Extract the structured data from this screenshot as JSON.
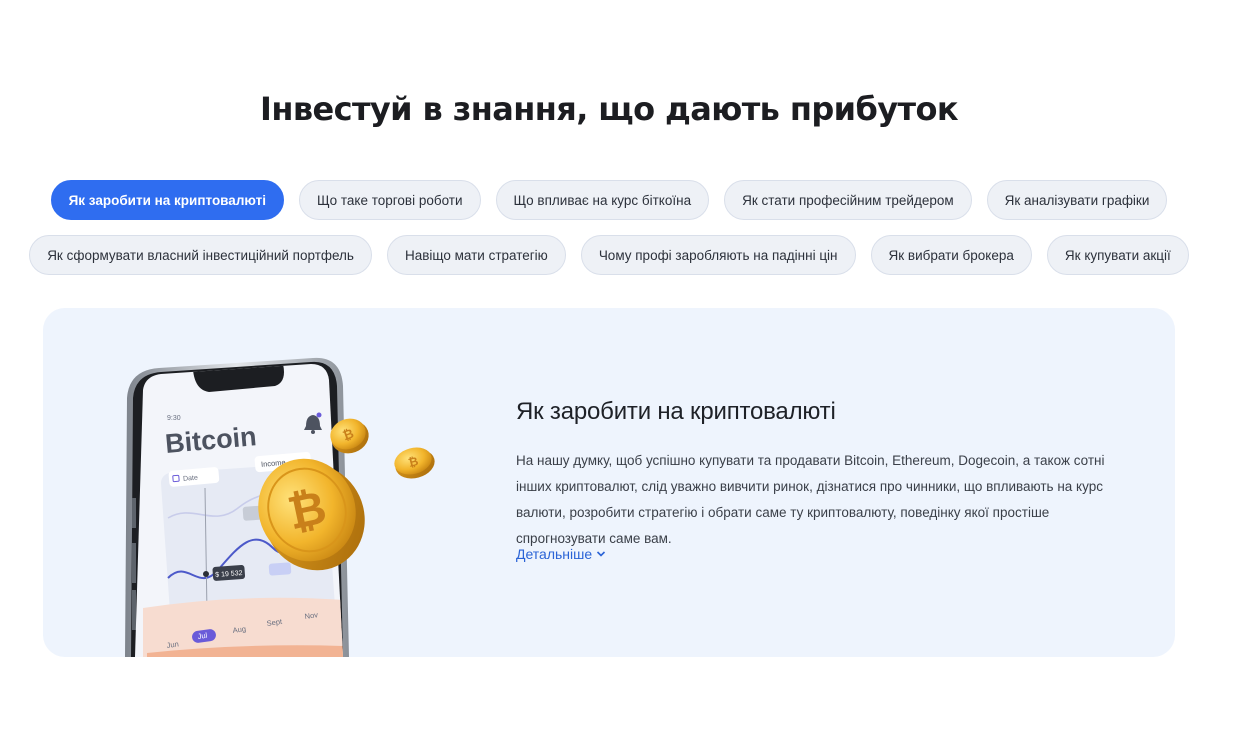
{
  "heading": "Інвестуй в знання, що дають прибуток",
  "topics_row1": [
    {
      "label": "Як заробити на криптовалюті",
      "active": true
    },
    {
      "label": "Що таке торгові роботи"
    },
    {
      "label": "Що впливає на курс біткоїна"
    },
    {
      "label": "Як стати професійним трейдером"
    },
    {
      "label": "Як аналізувати графіки"
    }
  ],
  "topics_row2": [
    {
      "label": "Як сформувати власний інвестиційний портфель"
    },
    {
      "label": "Навіщо мати стратегію"
    },
    {
      "label": "Чому профі заробляють на падінні цін"
    },
    {
      "label": "Як вибрати брокера"
    },
    {
      "label": "Як купувати акції"
    }
  ],
  "card": {
    "title": "Як заробити на криптовалюті",
    "text": "На нашу думку, щоб успішно купувати та продавати Bitcoin, Ethereum, Dogecoin, а також сотні інших криптовалют, слід уважно вивчити ринок, дізнатися про чинники, що впливають на курс валюти, розробити стратегію і обрати саме ту криптовалюту, поведінку якої простіше спрогнозувати саме вам.",
    "more_label": "Детальніше"
  },
  "phone": {
    "time": "9:30",
    "app_title": "Bitcoin",
    "date_label": "Date",
    "income_label": "Income",
    "price_tag": "$ 19 532",
    "months": [
      "Jun",
      "Jul",
      "Aug",
      "Sept",
      "Nov"
    ]
  },
  "colors": {
    "accent": "#2f6df0",
    "card_bg": "#eef4fd",
    "chip_bg": "#eef1f6",
    "link": "#2a63d6",
    "coin": "#f2b52c"
  }
}
